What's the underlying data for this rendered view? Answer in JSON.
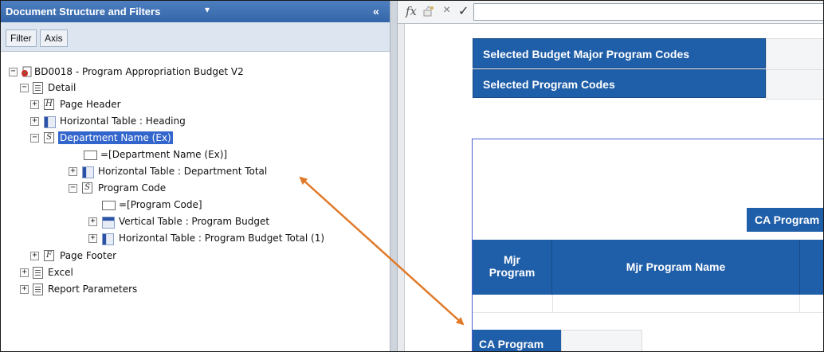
{
  "panel": {
    "title": "Document Structure and Filters",
    "title_caret": "▾",
    "collapse": "«",
    "tabs": [
      {
        "label": "Filter"
      },
      {
        "label": "Axis"
      }
    ]
  },
  "tree": {
    "root": "BD0018 - Program Appropriation Budget V2",
    "detail": "Detail",
    "page_header": "Page Header",
    "htable_heading": "Horizontal Table : Heading",
    "dept_name": "Department Name (Ex)",
    "dept_name_cell": "=[Department Name (Ex)]",
    "htable_dept_total": "Horizontal Table : Department Total",
    "program_code": "Program Code",
    "program_code_cell": "=[Program Code]",
    "vtable_prog_budget": "Vertical Table : Program Budget",
    "htable_prog_budget_total": "Horizontal Table : Program Budget Total (1)",
    "page_footer": "Page Footer",
    "excel": "Excel",
    "report_params": "Report Parameters",
    "letter_h": "H",
    "letter_s": "S",
    "letter_f": "F",
    "expand": "+",
    "collapse": "−"
  },
  "formula_bar": {
    "fx": "fx",
    "cancel": "×",
    "accept": "✓"
  },
  "report": {
    "selected_major_codes": "Selected Budget Major Program Codes",
    "selected_program_codes": "Selected Program Codes",
    "ca_program_header": "CA Program",
    "col_mjr_program_1": "Mjr",
    "col_mjr_program_2": "Program",
    "col_mjr_program_name": "Mjr Program Name",
    "ca_program_footer": "CA Program"
  },
  "colors": {
    "header_blue": "#1f5ea8",
    "selection": "#3366cc",
    "arrow": "#e07a2a"
  }
}
